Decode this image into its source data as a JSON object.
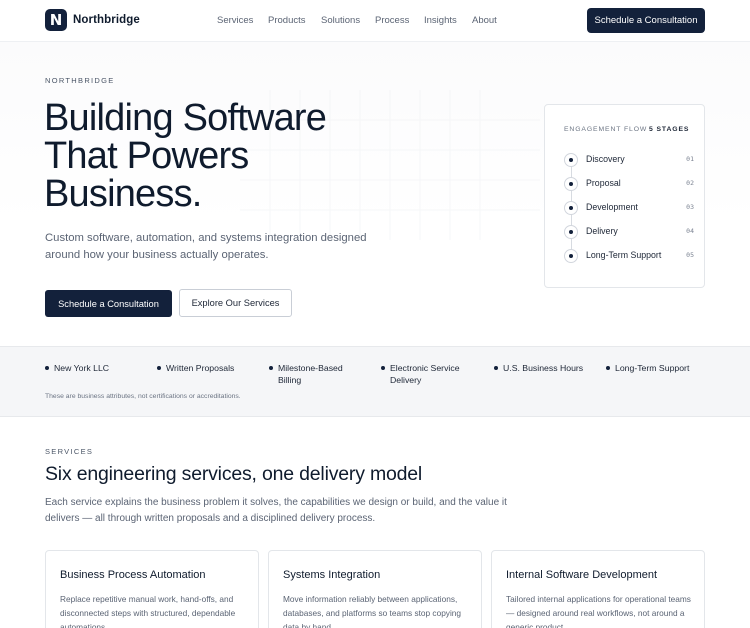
{
  "brand": {
    "logo_letter": "N",
    "name": "Northbridge"
  },
  "nav": {
    "links": [
      "Services",
      "Products",
      "Solutions",
      "Process",
      "Insights",
      "About"
    ],
    "cta": "Schedule a Consultation"
  },
  "hero": {
    "eyebrow": "NORTHBRIDGE",
    "title": "Building Software That Powers Business.",
    "subtitle": "Custom software, automation, and systems integration designed around how your business actually operates.",
    "primary_button": "Schedule a Consultation",
    "secondary_button": "Explore Our Services"
  },
  "engagement": {
    "heading": "ENGAGEMENT FLOW",
    "count": "5 STAGES",
    "steps": [
      {
        "label": "Discovery",
        "num": "01"
      },
      {
        "label": "Proposal",
        "num": "02"
      },
      {
        "label": "Development",
        "num": "03"
      },
      {
        "label": "Delivery",
        "num": "04"
      },
      {
        "label": "Long-Term Support",
        "num": "05"
      }
    ]
  },
  "attributes": {
    "items": [
      "New York LLC",
      "Written Proposals",
      "Milestone-Based Billing",
      "Electronic Service Delivery",
      "U.S. Business Hours",
      "Long-Term Support"
    ],
    "note": "These are business attributes, not certifications or accreditations."
  },
  "services": {
    "eyebrow": "SERVICES",
    "title": "Six engineering services, one delivery model",
    "subtitle": "Each service explains the business problem it solves, the capabilities we design or build, and the value it delivers — all through written proposals and a disciplined delivery process.",
    "cards": [
      {
        "title": "Business Process Automation",
        "body": "Replace repetitive manual work, hand-offs, and disconnected steps with structured, dependable automations."
      },
      {
        "title": "Systems Integration",
        "body": "Move information reliably between applications, databases, and platforms so teams stop copying data by hand."
      },
      {
        "title": "Internal Software Development",
        "body": "Tailored internal applications for operational teams — designed around real workflows, not around a generic product."
      }
    ]
  },
  "colors": {
    "primary": "#13213b",
    "text_muted": "#5b6474",
    "strip_bg": "#f5f6f8"
  }
}
